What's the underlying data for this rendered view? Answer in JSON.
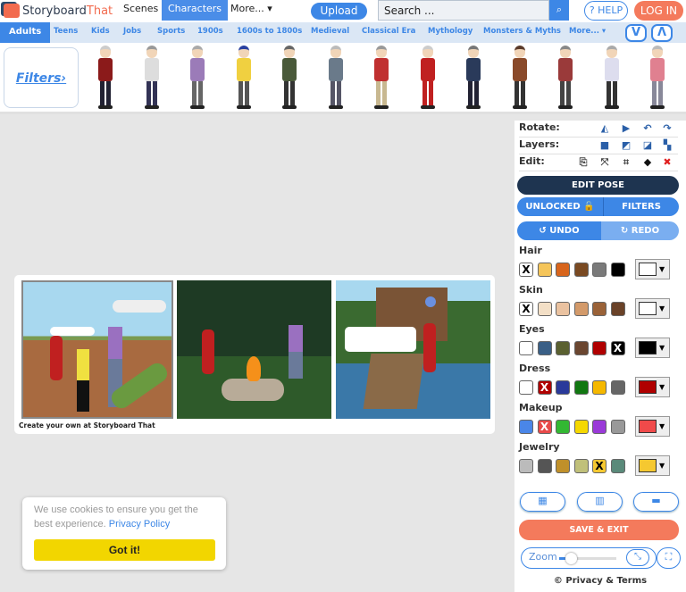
{
  "header": {
    "logo_left": "Storyboard",
    "logo_right": "That",
    "nav": [
      "Scenes",
      "Characters",
      "More... ▾"
    ],
    "active_nav": "Characters",
    "upload": "Upload",
    "search_placeholder": "Search ...",
    "help": "? HELP",
    "login": "LOG IN"
  },
  "categories": [
    "Adults",
    "Teens",
    "Kids",
    "Jobs",
    "Sports",
    "1900s",
    "1600s to 1800s",
    "Medieval",
    "Classical Era",
    "Mythology",
    "Monsters & Myths",
    "More... ▾"
  ],
  "scroll_down": "V",
  "scroll_up": "Λ",
  "filters_label": "Filters›",
  "characters": [
    {
      "hair": "#ccc",
      "top": "#8b1a1a",
      "legs": "#223"
    },
    {
      "hair": "#999",
      "top": "#ddd",
      "legs": "#335"
    },
    {
      "hair": "#aaa",
      "top": "#9b7bb8",
      "legs": "#666"
    },
    {
      "hair": "#2940a0",
      "top": "#f0d040",
      "legs": "#555"
    },
    {
      "hair": "#666",
      "top": "#4a5a3a",
      "legs": "#333"
    },
    {
      "hair": "#bbb",
      "top": "#6a7a8a",
      "legs": "#556"
    },
    {
      "hair": "#999",
      "top": "#c03030",
      "legs": "#c8b890"
    },
    {
      "hair": "#ccc",
      "top": "#c02020",
      "legs": "#c02020"
    },
    {
      "hair": "#777",
      "top": "#2a3a5a",
      "legs": "#223"
    },
    {
      "hair": "#5a3a2a",
      "top": "#8a4a2a",
      "legs": "#333"
    },
    {
      "hair": "#888",
      "top": "#9a3a3a",
      "legs": "#444"
    },
    {
      "hair": "#aaa",
      "top": "#dde",
      "legs": "#333"
    },
    {
      "hair": "#bbb",
      "top": "#e08090",
      "legs": "#889"
    }
  ],
  "panel": {
    "rotate": "Rotate:",
    "layers": "Layers:",
    "edit": "Edit:",
    "edit_pose": "EDIT POSE",
    "unlocked": "UNLOCKED 🔓",
    "filters": "FILTERS",
    "undo": "↺ UNDO",
    "redo": "↻ REDO",
    "colors": [
      {
        "label": "Hair",
        "swatches": [
          "#ffffff",
          "#f5c55a",
          "#d8651c",
          "#7a4a22",
          "#7a7a7a",
          "#000000"
        ],
        "selected": 0,
        "current": "#ffffff"
      },
      {
        "label": "Skin",
        "swatches": [
          "#ffffff",
          "#f3dfc6",
          "#eac2a0",
          "#d39a6a",
          "#9a6238",
          "#6a4228"
        ],
        "selected": 0,
        "current": "#ffffff"
      },
      {
        "label": "Eyes",
        "swatches": [
          "#ffffff",
          "#3a5f86",
          "#5a6030",
          "#6a4630",
          "#b00000",
          "#000000"
        ],
        "selected": 5,
        "current": "#000000"
      },
      {
        "label": "Dress",
        "swatches": [
          "#ffffff",
          "#b00000",
          "#2a3a9a",
          "#117711",
          "#f5b800",
          "#666666"
        ],
        "selected": 1,
        "current": "#b00000"
      },
      {
        "label": "Makeup",
        "swatches": [
          "#4a86e8",
          "#e84a4a",
          "#33b833",
          "#f5d800",
          "#9a3ad8",
          "#999999"
        ],
        "selected": 1,
        "current": "#f04a4a"
      },
      {
        "label": "Jewelry",
        "swatches": [
          "#bbbbbb",
          "#555555",
          "#c0902a",
          "#c0c07a",
          "#f5c830",
          "#5a8a7a"
        ],
        "selected": 4,
        "current": "#f5c830"
      }
    ],
    "save_exit": "SAVE & EXIT",
    "zoom": "Zoom",
    "zoom_level": 0.2,
    "privacy": "© Privacy & Terms"
  },
  "storyboard": {
    "caption": "Create your own at Storyboard That"
  },
  "cookie": {
    "text": "We use cookies to ensure you get the best experience.",
    "link": "Privacy Policy",
    "button": "Got it!"
  },
  "colors": {
    "accent": "#3d87e6",
    "save": "#f47a5c",
    "dark": "#1e3450"
  }
}
